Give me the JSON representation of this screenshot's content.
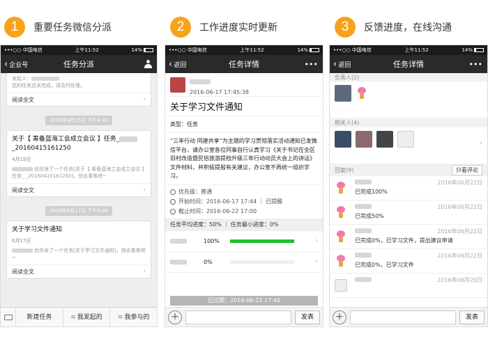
{
  "steps": [
    {
      "num": "1",
      "title": "重要任务微信分派"
    },
    {
      "num": "2",
      "title": "工作进度实时更新"
    },
    {
      "num": "3",
      "title": "反馈进度，在线沟通"
    }
  ],
  "status": {
    "carrier": "中国电信",
    "time": "上午11:52",
    "battery": "14%"
  },
  "phone1": {
    "nav_back": "企业号",
    "nav_title": "任务分派",
    "card0": {
      "line1": "发起人：",
      "line2": "您的任务还未完成，请及时处理。",
      "footer": "阅读全文"
    },
    "date1": "2016年4月15日 下午4:45",
    "card1": {
      "title_a": "关于【 筹备蓝海工会成立会议 】任务_",
      "title_b": "_20160415161250",
      "date": "4月15日",
      "msg": "给你发了一个任务[关于【 筹备蓝海工会成立会议 】任务_         _20160415161250]，快去看看吧~",
      "footer": "阅读全文"
    },
    "date2": "2016年6月17日 下午5:46",
    "card2": {
      "title": "关于学习文件通知",
      "date": "6月17日",
      "msg": "给你发了一个任务[关于学习文件通知]，快去看看吧~",
      "footer": "阅读全文"
    },
    "tabs": [
      "新建任务",
      "我发起的",
      "我参与的"
    ]
  },
  "phone2": {
    "nav_back": "返回",
    "nav_title": "任务详情",
    "nav_more": "•••",
    "timestamp": "2016-06-17 17:45:38",
    "title": "关于学习文件通知",
    "type": "类型：任务",
    "content": "“三年行动 同建共享”为主题的学习贯彻落实活动通知已发微信平台，请办公室各位同事自行认真学习《关于书记在全区旧村改造暨民俗旅游提档升级三年行动动员大会上的讲话》文件材料，并积极提报有关建议，办公室不再统一组织学习。",
    "priority": "优先级：普通",
    "start": "开始时间：2016-06-17 17:44 ｜ 已提醒",
    "end": "截止时间：2016-06-22 17:00",
    "progress_summary": "任务平均进度：50% ｜ 任务最小进度：0%",
    "rows": [
      {
        "pct": "100%",
        "value": 100
      },
      {
        "pct": "0%",
        "value": 0
      }
    ],
    "expired": "已过期：2016-06-22 17:40",
    "send": "发表"
  },
  "phone3": {
    "nav_back": "返回",
    "nav_title": "任务详情",
    "nav_more": "•••",
    "owner_header": "负责人(2)",
    "related_header": "相关人(4)",
    "reply_header": "回复(9)",
    "view_reviews": "只看评论",
    "replies": [
      {
        "text": "已完成100%",
        "date": "2016年06月22日"
      },
      {
        "text": "已完成50%",
        "date": "2016年06月22日"
      },
      {
        "text": "已完成0%，已学习文件，提出建议申请",
        "date": "2016年06月22日"
      },
      {
        "text": "已完成0%，已学习文件",
        "date": "2016年06月22日"
      },
      {
        "text": "",
        "date": "2016年06月20日"
      }
    ],
    "send": "发表"
  }
}
